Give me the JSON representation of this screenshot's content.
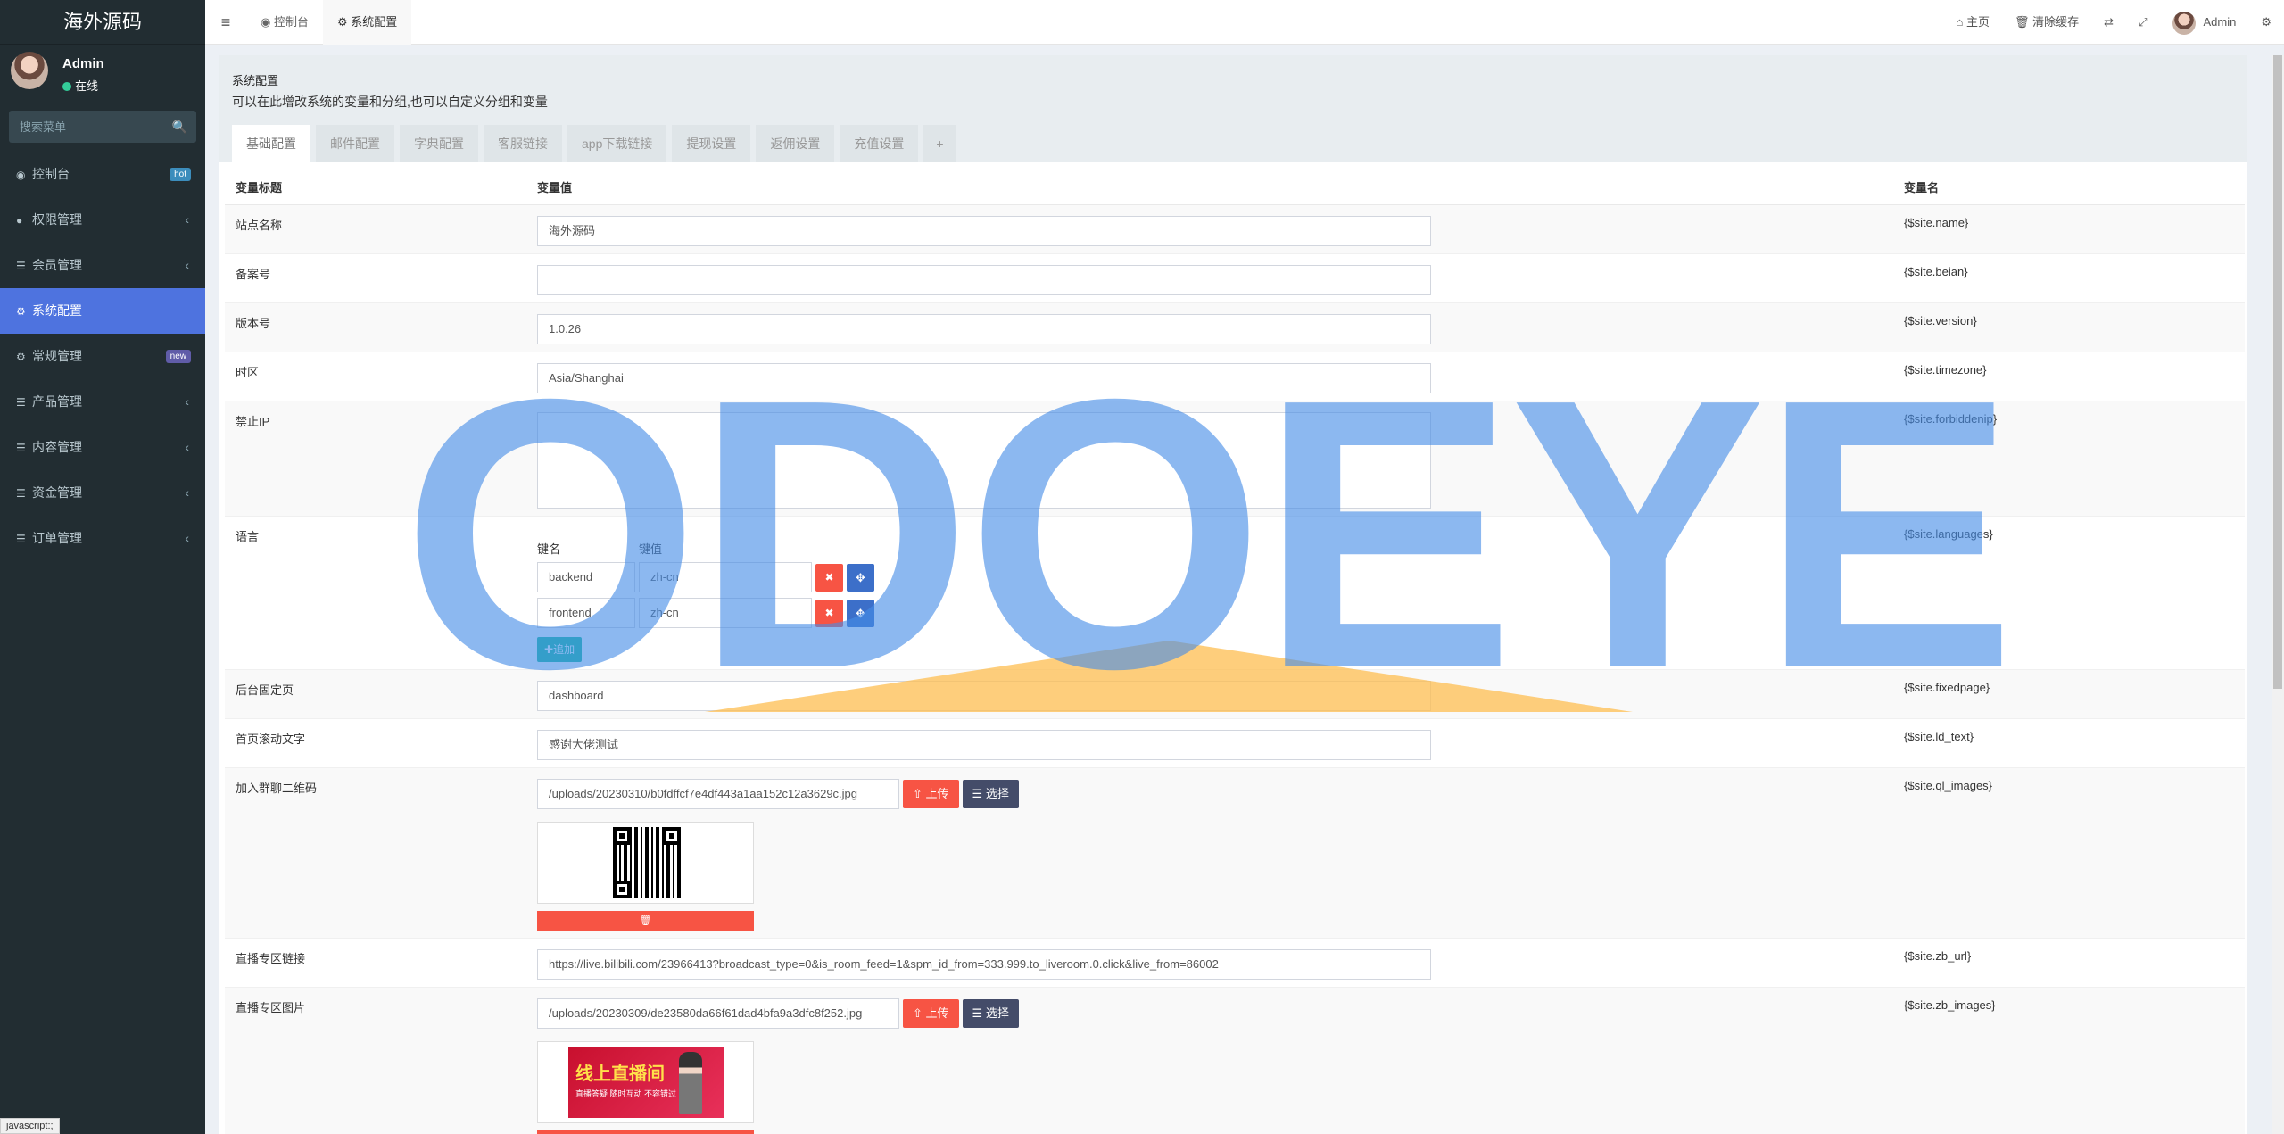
{
  "sidebar": {
    "brand": "海外源码",
    "user": {
      "name": "Admin",
      "status": "在线"
    },
    "search_placeholder": "搜索菜单",
    "items": [
      {
        "label": "控制台",
        "badge": "hot"
      },
      {
        "label": "权限管理"
      },
      {
        "label": "会员管理"
      },
      {
        "label": "系统配置",
        "active": true
      },
      {
        "label": "常规管理",
        "badge": "new"
      },
      {
        "label": "产品管理"
      },
      {
        "label": "内容管理"
      },
      {
        "label": "资金管理"
      },
      {
        "label": "订单管理"
      }
    ]
  },
  "navbar": {
    "tabs": [
      "控制台",
      "系统配置"
    ],
    "home": "主页",
    "clear_cache": "清除缓存",
    "user": "Admin"
  },
  "panel": {
    "title": "系统配置",
    "description": "可以在此增改系统的变量和分组,也可以自定义分组和变量",
    "tabs": [
      "基础配置",
      "邮件配置",
      "字典配置",
      "客服链接",
      "app下载链接",
      "提现设置",
      "返佣设置",
      "充值设置"
    ],
    "add_tab": "+"
  },
  "table": {
    "headers": [
      "变量标题",
      "变量值",
      "变量名"
    ],
    "rows": {
      "name": {
        "label": "站点名称",
        "value": "海外源码",
        "var": "{$site.name}"
      },
      "beian": {
        "label": "备案号",
        "value": "",
        "var": "{$site.beian}"
      },
      "version": {
        "label": "版本号",
        "value": "1.0.26",
        "var": "{$site.version}"
      },
      "timezone": {
        "label": "时区",
        "value": "Asia/Shanghai",
        "var": "{$site.timezone}"
      },
      "forbiddenip": {
        "label": "禁止IP",
        "value": "",
        "var": "{$site.forbiddenip}"
      },
      "languages": {
        "label": "语言",
        "key_header": "键名",
        "val_header": "键值",
        "pairs": [
          {
            "key": "backend",
            "value": "zh-cn"
          },
          {
            "key": "frontend",
            "value": "zh-cn"
          }
        ],
        "add_label": "追加",
        "var": "{$site.languages}"
      },
      "fixedpage": {
        "label": "后台固定页",
        "value": "dashboard",
        "var": "{$site.fixedpage}"
      },
      "ld_text": {
        "label": "首页滚动文字",
        "value": "感谢大佬测试",
        "var": "{$site.ld_text}"
      },
      "ql_images": {
        "label": "加入群聊二维码",
        "value": "/uploads/20230310/b0fdffcf7e4df443a1aa152c12a3629c.jpg",
        "upload": "上传",
        "select": "选择",
        "var": "{$site.ql_images}"
      },
      "zb_url": {
        "label": "直播专区链接",
        "value": "https://live.bilibili.com/23966413?broadcast_type=0&is_room_feed=1&spm_id_from=333.999.to_liveroom.0.click&live_from=86002",
        "var": "{$site.zb_url}"
      },
      "zb_images": {
        "label": "直播专区图片",
        "value": "/uploads/20230309/de23580da66f61dad4bfa9a3dfc8f252.jpg",
        "upload": "上传",
        "select": "选择",
        "var": "{$site.zb_images}",
        "banner_title": "线上直播间",
        "banner_sub": "直播答疑 随时互动 不容错过"
      }
    }
  },
  "watermark": "ODOEYE",
  "statusbar": "javascript:;"
}
